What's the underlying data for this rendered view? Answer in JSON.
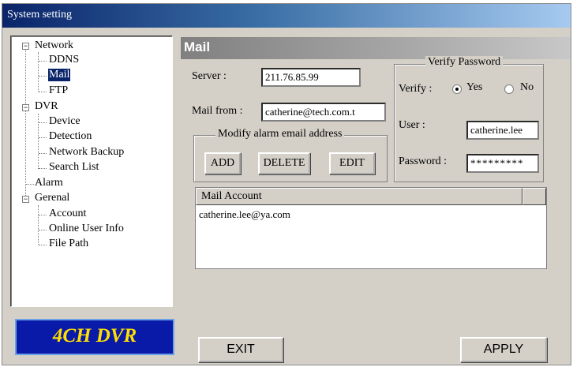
{
  "window": {
    "title": "System setting"
  },
  "tree": {
    "network": {
      "label": "Network",
      "children": [
        "DDNS",
        "Mail",
        "FTP"
      ]
    },
    "dvr": {
      "label": "DVR",
      "children": [
        "Device",
        "Detection",
        "Network Backup",
        "Search List"
      ]
    },
    "alarm": {
      "label": "Alarm"
    },
    "general": {
      "label": "Gerenal",
      "children": [
        "Account",
        "Online User Info",
        "File Path"
      ]
    },
    "selected": "Mail",
    "expander": "−"
  },
  "logo": {
    "text": "4CH DVR"
  },
  "panel": {
    "title": "Mail"
  },
  "server": {
    "label": "Server :",
    "value": "211.76.85.99"
  },
  "mail_from": {
    "label": "Mail from :",
    "value": "catherine@tech.com.t"
  },
  "alarm_group": {
    "title": "Modify alarm email address",
    "add": "ADD",
    "delete": "DELETE",
    "edit": "EDIT"
  },
  "verify": {
    "title": "Verify Password",
    "label": "Verify :",
    "yes": "Yes",
    "no": "No",
    "selected": "Yes",
    "user_label": "User :",
    "user_value": "catherine.lee",
    "password_label": "Password :",
    "password_value": "*********"
  },
  "mail_account": {
    "header": "Mail Account",
    "rows": [
      "catherine.lee@ya.com"
    ]
  },
  "buttons": {
    "exit": "EXIT",
    "apply": "APPLY"
  }
}
